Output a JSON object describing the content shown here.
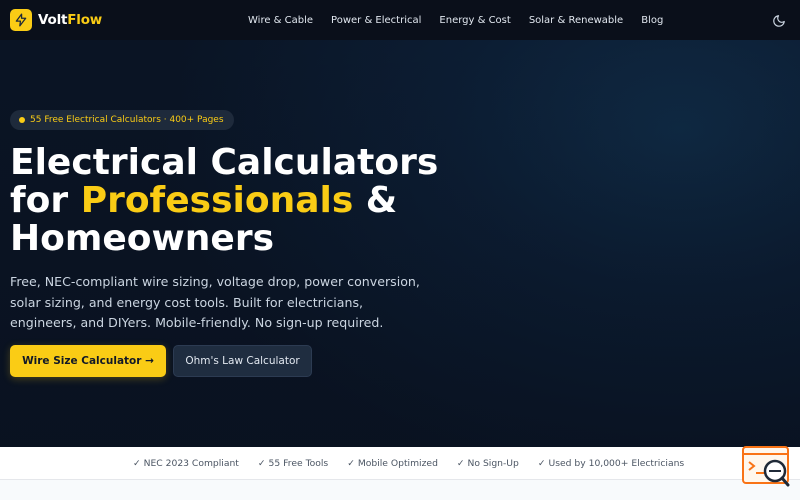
{
  "brand": {
    "name_part1": "Volt",
    "name_part2": "Flow",
    "accent_color": "#facc15"
  },
  "nav": {
    "links": [
      "Wire & Cable",
      "Power & Electrical",
      "Energy & Cost",
      "Solar & Renewable",
      "Blog"
    ],
    "theme_icon": "moon-icon"
  },
  "hero": {
    "badge": "55 Free Electrical Calculators · 400+ Pages",
    "headline_line1": "Electrical Calculators",
    "headline_for": "for ",
    "headline_accent": "Professionals",
    "headline_amp": " &",
    "headline_line3": "Homeowners",
    "description": "Free, NEC-compliant wire sizing, voltage drop, power conversion, solar sizing, and energy cost tools. Built for electricians, engineers, and DIYers. Mobile-friendly. No sign-up required.",
    "primary_cta": "Wire Size Calculator →",
    "secondary_cta": "Ohm's Law Calculator"
  },
  "trust_bar": {
    "items": [
      "✓ NEC 2023 Compliant",
      "✓ 55 Free Tools",
      "✓ Mobile Optimized",
      "✓ No Sign-Up",
      "✓ Used by 10,000+ Electricians"
    ]
  },
  "icons": {
    "logo": "lightning-bolt-icon",
    "widget": "search-console-icon"
  }
}
